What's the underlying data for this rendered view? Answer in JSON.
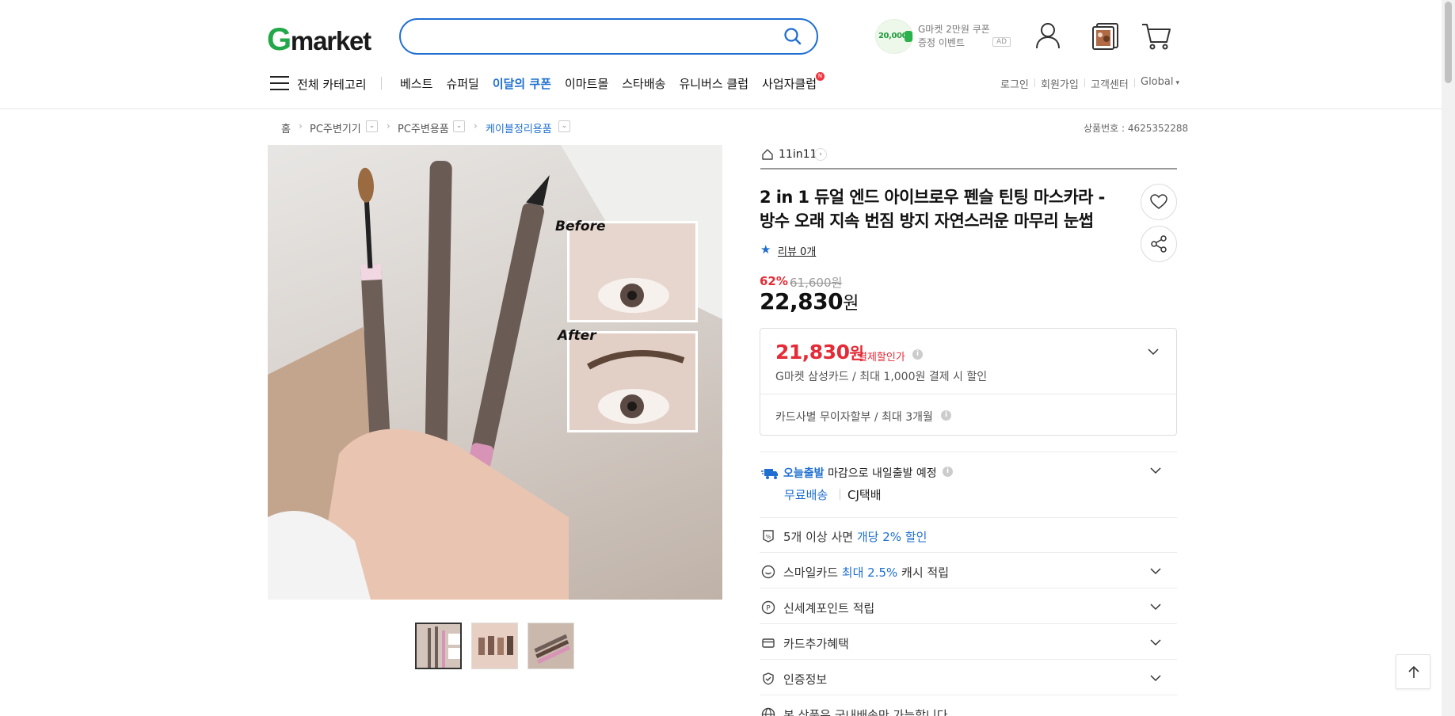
{
  "header": {
    "logo_g": "G",
    "logo_rest": "market",
    "search": {
      "placeholder": ""
    },
    "promo": {
      "amount": "20,000",
      "line1": "G마켓 2만원 쿠폰",
      "line2": "증정 이벤트",
      "ad": "AD"
    }
  },
  "gnb": {
    "all_categories": "전체 카테고리",
    "links": [
      {
        "label": "베스트",
        "highlight": false
      },
      {
        "label": "슈퍼딜",
        "highlight": false
      },
      {
        "label": "이달의 쿠폰",
        "highlight": true
      },
      {
        "label": "이마트몰",
        "highlight": false
      },
      {
        "label": "스타배송",
        "highlight": false
      },
      {
        "label": "유니버스 클럽",
        "highlight": false
      },
      {
        "label": "사업자클럽",
        "highlight": false,
        "badge": "N"
      }
    ],
    "util": [
      "로그인",
      "회원가입",
      "고객센터",
      "Global"
    ]
  },
  "breadcrumb": {
    "items": [
      "홈",
      "PC주변기기",
      "PC주변용품",
      "케이블정리용품"
    ],
    "sku_label": "상품번호 : 4625352288"
  },
  "product": {
    "image_text": {
      "before": "Before",
      "after": "After"
    },
    "store": "11in11",
    "title": "2 in 1 듀얼 엔드 아이브로우 펜슬 틴팅 마스카라 - 방수 오래 지속 번짐 방지 자연스러운 마무리 눈썹",
    "review": "리뷰 0개",
    "discount": "62%",
    "original_price": "61,600원",
    "price": "22,830",
    "won": "원"
  },
  "price_box": {
    "price": "21,830",
    "won": "원",
    "label": "결제할인가",
    "sub": "G마켓 삼성카드 / 최대 1,000원 결제 시 할인",
    "installment": "카드사별 무이자할부 / 최대 3개월"
  },
  "shipping": {
    "title_bold": "오늘출발",
    "title_rest": "마감으로 내일출발 예정",
    "free": "무료배송",
    "carrier": "CJ택배"
  },
  "benefits": {
    "bulk": {
      "pre": "5개 이상 사면 ",
      "blue": "개당 2% 할인",
      "post": ""
    },
    "smile": {
      "pre": "스마일카드 ",
      "blue": "최대 2.5%",
      "post": " 캐시 적립"
    },
    "shinsegae": "신세계포인트 적립",
    "card": "카드추가혜택",
    "cert": "인증정보",
    "domestic": "본 상품은 국내배송만 가능합니다"
  },
  "colors": {
    "brand_green": "#22a84a",
    "accent_blue": "#1f6fd1",
    "sale_red": "#e52b36"
  }
}
